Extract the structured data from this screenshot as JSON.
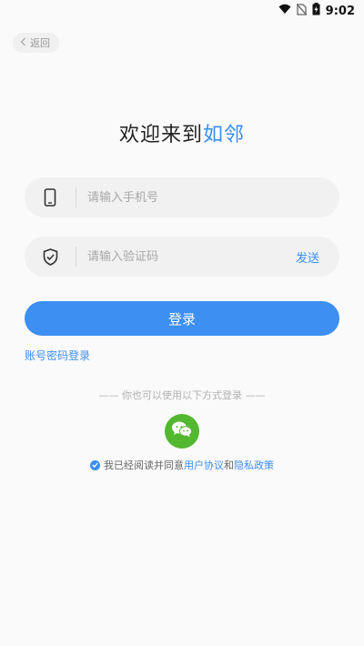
{
  "status_bar": {
    "time": "9:02"
  },
  "back": {
    "label": "返回"
  },
  "welcome": {
    "prefix": "欢迎来到",
    "brand": "如邻"
  },
  "phone_field": {
    "placeholder": "请输入手机号",
    "value": ""
  },
  "code_field": {
    "placeholder": "请输入验证码",
    "value": "",
    "send_label": "发送"
  },
  "login_button": {
    "label": "登录"
  },
  "password_login": {
    "label": "账号密码登录"
  },
  "other_ways": {
    "label": "—— 你也可以使用以下方式登录 ——"
  },
  "agreement": {
    "prefix": "我已经阅读并同意",
    "user_agreement": "用户协议",
    "and": "和",
    "privacy_policy": "隐私政策"
  },
  "colors": {
    "accent": "#3a8ef0",
    "wechat": "#52b830",
    "field_bg": "#f1f1f1"
  }
}
